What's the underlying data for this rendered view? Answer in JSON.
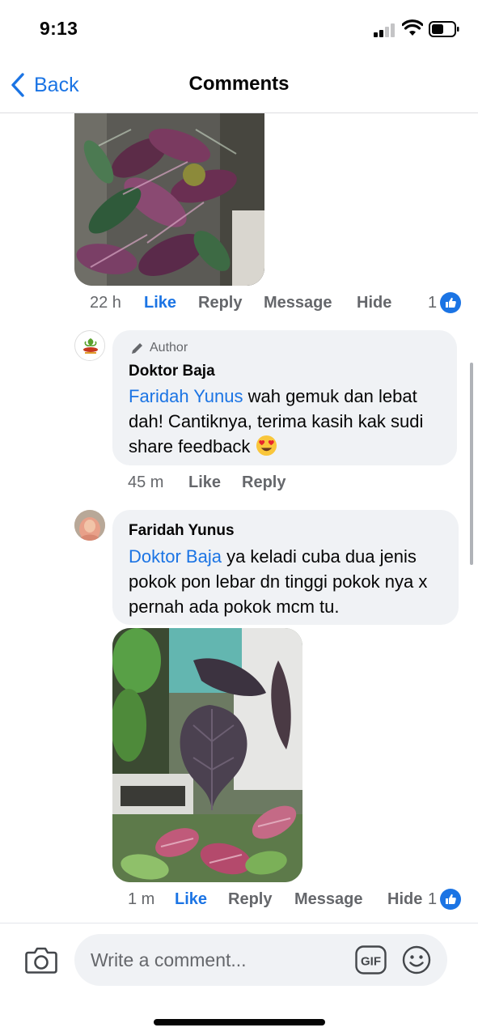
{
  "status_bar": {
    "time": "9:13"
  },
  "nav": {
    "back_label": "Back",
    "title": "Comments"
  },
  "comments": [
    {
      "id": "prev",
      "timestamp": "22 h",
      "like": "Like",
      "reply": "Reply",
      "message": "Message",
      "hide": "Hide",
      "reaction_count": "1"
    },
    {
      "id": "doktor-baja",
      "author_badge": "Author",
      "name": "Doktor Baja",
      "mention": "Faridah Yunus",
      "text": " wah gemuk dan lebat dah! Cantiknya, terima kasih kak sudi share feedback ",
      "emoji": "heart-eyes-emoji",
      "timestamp": "45 m",
      "like": "Like",
      "reply": "Reply"
    },
    {
      "id": "faridah-yunus",
      "name": "Faridah Yunus",
      "mention": "Doktor Baja",
      "text": " ya keladi cuba dua jenis pokok pon lebar dn tinggi pokok nya x pernah ada pokok mcm tu.",
      "timestamp": "1 m",
      "like": "Like",
      "reply": "Reply",
      "message": "Message",
      "hide": "Hide",
      "reaction_count": "1"
    }
  ],
  "composer": {
    "placeholder": "Write a comment...",
    "gif_label": "GIF"
  },
  "colors": {
    "accent": "#1b74e4",
    "bubble": "#f0f2f5",
    "meta": "#65676b"
  }
}
